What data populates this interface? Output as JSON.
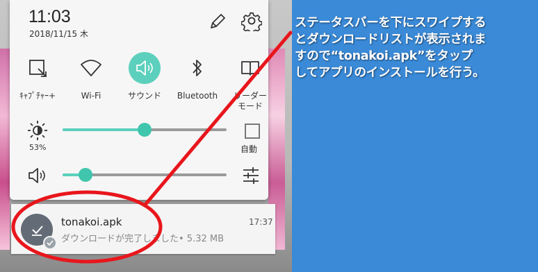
{
  "status": {
    "time": "11:03",
    "date": "2018/11/15 木"
  },
  "tiles": [
    {
      "label": "ｷｬﾌﾟﾁｬｰ+",
      "icon": "capture-icon"
    },
    {
      "label": "Wi-Fi",
      "icon": "wifi-icon"
    },
    {
      "label": "サウンド",
      "icon": "sound-icon",
      "active": true
    },
    {
      "label": "Bluetooth",
      "icon": "bluetooth-icon"
    },
    {
      "label": "リーダー\nモード",
      "icon": "reader-mode-icon"
    }
  ],
  "brightness": {
    "percent_label": "53%",
    "level": 0.5,
    "auto_label": "自動"
  },
  "volume": {
    "level": 0.14
  },
  "notification": {
    "title": "tonakoi.apk",
    "time": "17:37",
    "description": "ダウンロードが完了しました• 5.32 MB"
  },
  "annotation": {
    "text": "ステータスバーを下にスワイプする\nとダウンロードリストが表示されま\nすので“tonakoi.apk”をタップ\nしてアプリのインストールを行う。",
    "color": "#e8161c"
  },
  "colors": {
    "accent": "#5cd0bc",
    "background": "#3a8ad8"
  }
}
